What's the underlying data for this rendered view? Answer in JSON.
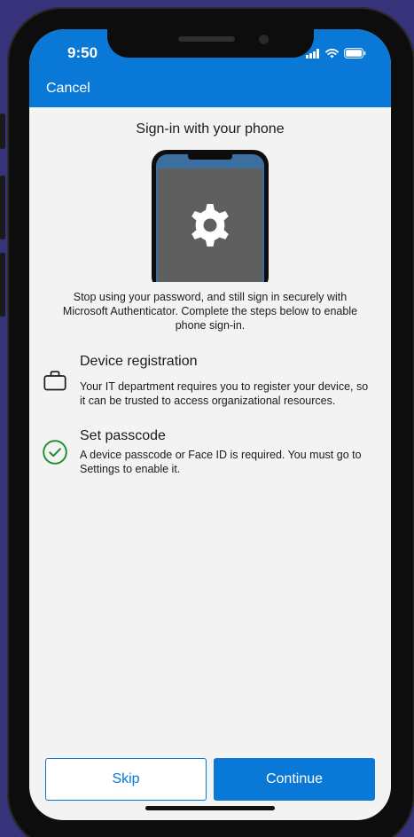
{
  "status_bar": {
    "time": "9:50"
  },
  "header": {
    "cancel_label": "Cancel"
  },
  "main": {
    "title": "Sign-in with your phone",
    "intro": "Stop using your password, and still sign in securely with Microsoft Authenticator. Complete the steps below to enable phone sign-in.",
    "steps": [
      {
        "title": "Device registration",
        "description": "Your IT department requires you to register your device, so it can be trusted to access organizational resources.",
        "icon": "briefcase-icon",
        "completed": false
      },
      {
        "title": "Set passcode",
        "description": "A device passcode or Face ID is required. You must go to Settings to enable it.",
        "icon": "checkmark-circle-icon",
        "completed": true
      }
    ]
  },
  "footer": {
    "skip_label": "Skip",
    "continue_label": "Continue"
  },
  "colors": {
    "accent": "#0a78d6",
    "success": "#1f8a2e",
    "background": "#f3f3f3"
  }
}
